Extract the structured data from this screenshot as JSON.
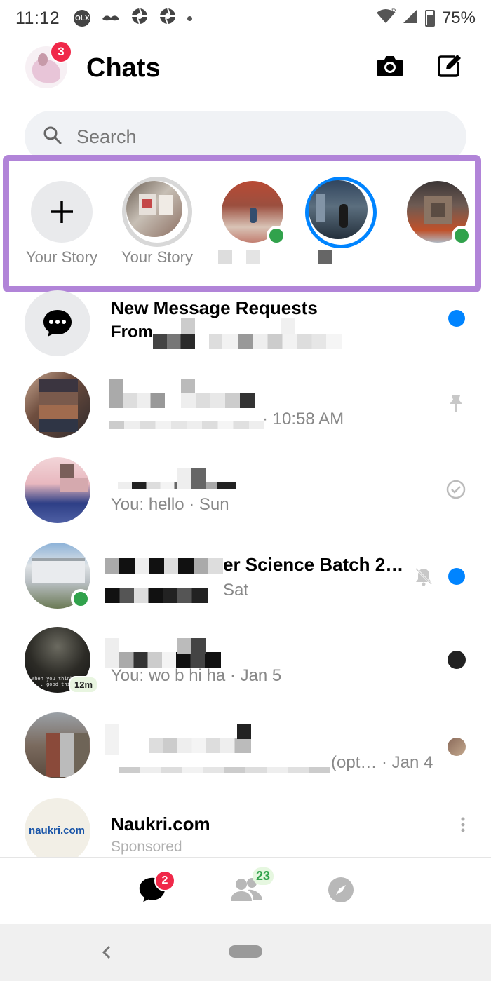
{
  "status": {
    "time": "11:12",
    "battery": "75%",
    "icons": [
      "olx-icon",
      "mustache-icon",
      "aperture-icon",
      "aperture-icon",
      "dot-icon"
    ]
  },
  "header": {
    "title": "Chats",
    "notification_count": "3"
  },
  "search": {
    "placeholder": "Search"
  },
  "stories": [
    {
      "label": "Your Story",
      "type": "add"
    },
    {
      "label": "Your Story",
      "type": "own"
    },
    {
      "label": "",
      "type": "friend",
      "online": true
    },
    {
      "label": "",
      "type": "friend",
      "active_ring": true
    },
    {
      "label": "",
      "type": "friend",
      "online": true
    }
  ],
  "chats": [
    {
      "name": "New Message Requests",
      "subtitle_prefix": "From",
      "unread": true
    },
    {
      "name": "",
      "subtitle": "· 10:58 AM",
      "status_icon": "pin-icon"
    },
    {
      "name": "",
      "subtitle": "You: hello · Sun",
      "status_icon": "check-icon"
    },
    {
      "name": "er Science Batch 2…",
      "subtitle": "Sat",
      "status_icon": "muted-bell-icon",
      "unread": true,
      "online": true
    },
    {
      "name": "",
      "subtitle": "You: wo b hi ha · Jan 5",
      "avatar_badge": "12m",
      "avatar_caption": "When you think p... good things happ..."
    },
    {
      "name": "",
      "subtitle": "(opt… · Jan 4"
    },
    {
      "name": "Naukri.com",
      "subtitle": "Sponsored",
      "avatar_logo": "naukri.com"
    }
  ],
  "nav": {
    "chats_badge": "2",
    "people_badge": "23"
  },
  "colors": {
    "accent": "#0084ff",
    "badge": "#f02849",
    "online": "#31a24c",
    "highlight_border": "#b184d8"
  }
}
